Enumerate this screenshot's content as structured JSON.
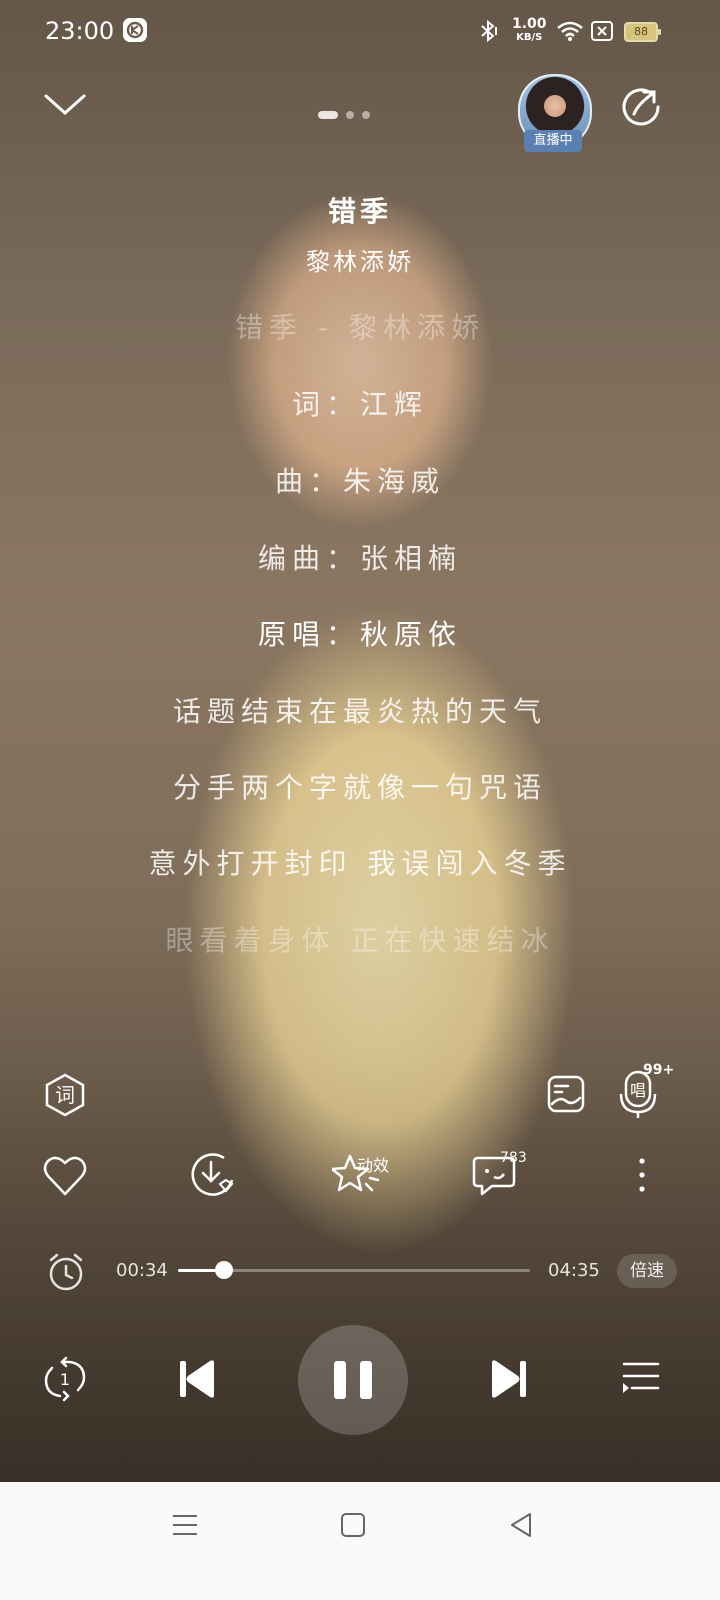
{
  "status_bar": {
    "time": "23:00",
    "net_speed_value": "1.00",
    "net_speed_unit": "KB/S",
    "battery": "88",
    "icons": [
      "app-notification-icon",
      "bluetooth-icon",
      "wifi-icon",
      "sim-off-icon",
      "battery-icon"
    ]
  },
  "top_bar": {
    "collapse_icon": "chevron-down-icon",
    "page_dots": 3,
    "active_dot": 0,
    "live_badge": "直播中",
    "share_icon": "share-icon"
  },
  "song": {
    "title": "错季",
    "artist": "黎林添娇"
  },
  "lyrics": [
    {
      "text": "错季 - 黎林添娇",
      "state": "dim"
    },
    {
      "text": "词：江辉",
      "state": "normal"
    },
    {
      "text": "曲：朱海威",
      "state": "normal"
    },
    {
      "text": "编曲：张相楠",
      "state": "normal"
    },
    {
      "text": "原唱：秋原依",
      "state": "bright"
    },
    {
      "text": "话题结束在最炎热的天气",
      "state": "normal"
    },
    {
      "text": "分手两个字就像一句咒语",
      "state": "normal"
    },
    {
      "text": "意外打开封印 我误闯入冬季",
      "state": "normal"
    },
    {
      "text": "眼看着身体 正在快速结冰",
      "state": "dim"
    }
  ],
  "tools": {
    "lyrics_label": "词",
    "sing_count": "99+"
  },
  "actions": {
    "effects_label": "动效",
    "comment_count": "783"
  },
  "progress": {
    "current": "00:34",
    "total": "04:35",
    "fraction": 0.13,
    "speed_label": "倍速"
  },
  "colors": {
    "live_badge": "#5a7fb3",
    "nav_bar": "#fafafa"
  }
}
